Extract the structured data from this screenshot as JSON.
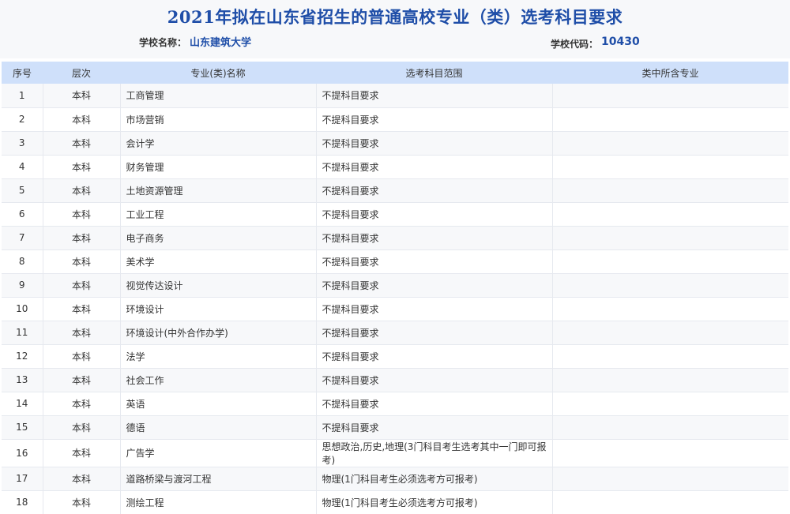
{
  "title": "2021年拟在山东省招生的普通高校专业（类）选考科目要求",
  "school": {
    "name_label": "学校名称：",
    "name": "山东建筑大学",
    "code_label": "学校代码：",
    "code": "10430"
  },
  "table": {
    "headers": [
      "序号",
      "层次",
      "专业(类)名称",
      "选考科目范围",
      "类中所含专业"
    ],
    "rows": [
      [
        "1",
        "本科",
        "工商管理",
        "不提科目要求",
        ""
      ],
      [
        "2",
        "本科",
        "市场营销",
        "不提科目要求",
        ""
      ],
      [
        "3",
        "本科",
        "会计学",
        "不提科目要求",
        ""
      ],
      [
        "4",
        "本科",
        "财务管理",
        "不提科目要求",
        ""
      ],
      [
        "5",
        "本科",
        "土地资源管理",
        "不提科目要求",
        ""
      ],
      [
        "6",
        "本科",
        "工业工程",
        "不提科目要求",
        ""
      ],
      [
        "7",
        "本科",
        "电子商务",
        "不提科目要求",
        ""
      ],
      [
        "8",
        "本科",
        "美术学",
        "不提科目要求",
        ""
      ],
      [
        "9",
        "本科",
        "视觉传达设计",
        "不提科目要求",
        ""
      ],
      [
        "10",
        "本科",
        "环境设计",
        "不提科目要求",
        ""
      ],
      [
        "11",
        "本科",
        "环境设计(中外合作办学)",
        "不提科目要求",
        ""
      ],
      [
        "12",
        "本科",
        "法学",
        "不提科目要求",
        ""
      ],
      [
        "13",
        "本科",
        "社会工作",
        "不提科目要求",
        ""
      ],
      [
        "14",
        "本科",
        "英语",
        "不提科目要求",
        ""
      ],
      [
        "15",
        "本科",
        "德语",
        "不提科目要求",
        ""
      ],
      [
        "16",
        "本科",
        "广告学",
        "思想政治,历史,地理(3门科目考生选考其中一门即可报考)",
        ""
      ],
      [
        "17",
        "本科",
        "道路桥梁与渡河工程",
        "物理(1门科目考生必须选考方可报考)",
        ""
      ],
      [
        "18",
        "本科",
        "测绘工程",
        "物理(1门科目考生必须选考方可报考)",
        ""
      ]
    ]
  }
}
